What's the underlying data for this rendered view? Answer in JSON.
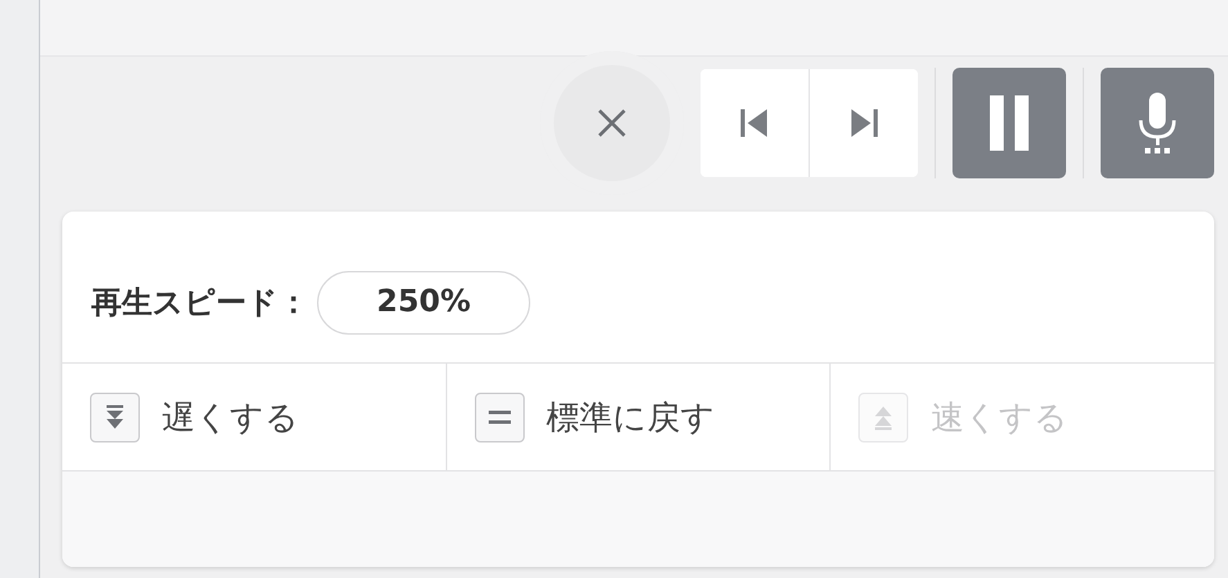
{
  "toolbar": {
    "buttons": [
      {
        "kind": "close"
      },
      {
        "kind": "previous"
      },
      {
        "kind": "next"
      },
      {
        "kind": "pause"
      },
      {
        "kind": "microphone"
      }
    ]
  },
  "speed_panel": {
    "label": "再生スピード：",
    "value": "250%",
    "actions": [
      {
        "kind": "slower",
        "label": "遅くする",
        "disabled": false
      },
      {
        "kind": "reset",
        "label": "標準に戻す",
        "disabled": false
      },
      {
        "kind": "faster",
        "label": "速くする",
        "disabled": true
      }
    ]
  }
}
